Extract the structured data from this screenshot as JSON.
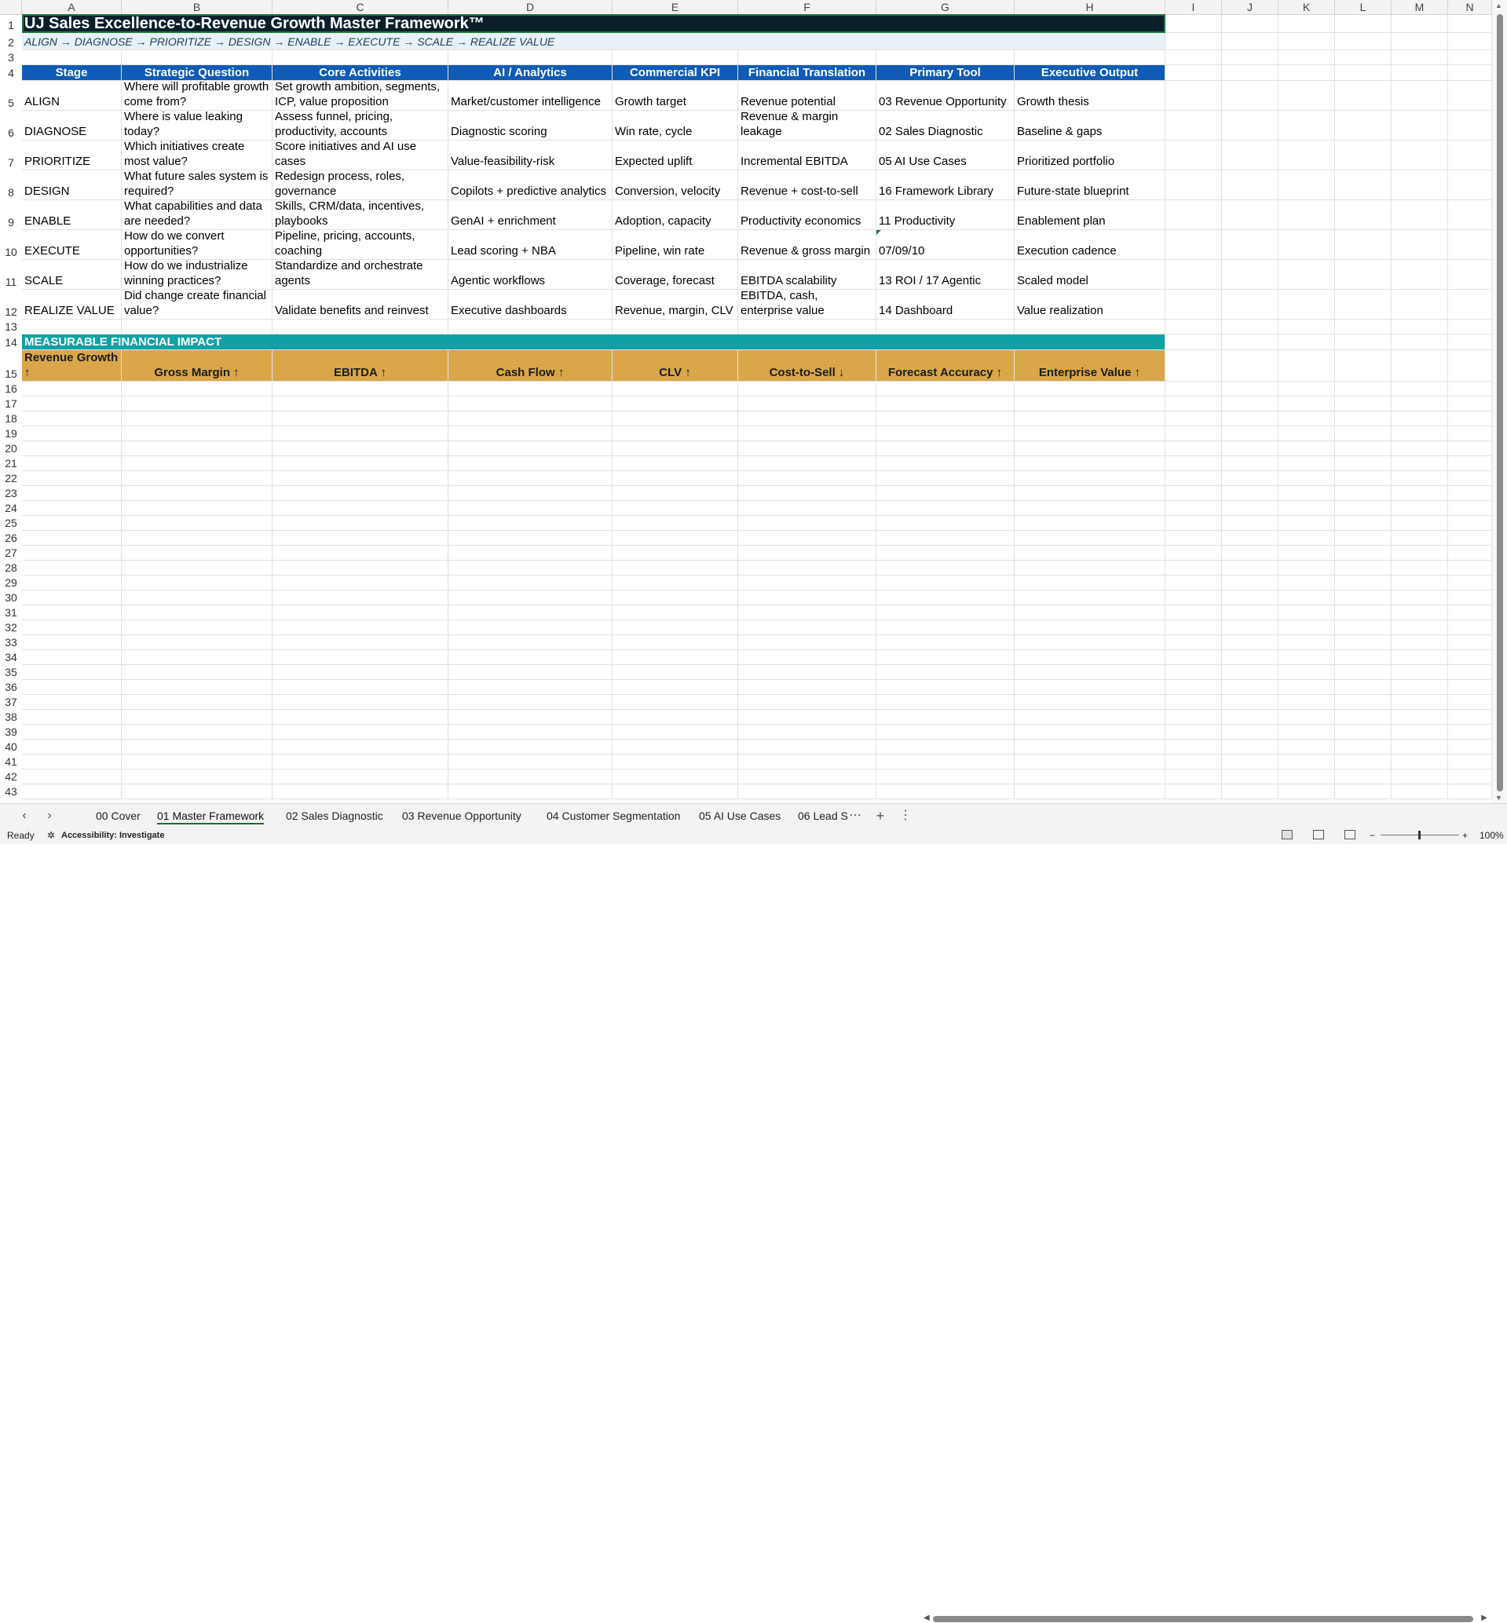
{
  "columns": [
    "A",
    "B",
    "C",
    "D",
    "E",
    "F",
    "G",
    "H",
    "I",
    "J",
    "K",
    "L",
    "M",
    "N"
  ],
  "title": "UJ Sales Excellence-to-Revenue Growth Master Framework™",
  "subtitle": "ALIGN → DIAGNOSE → PRIORITIZE → DESIGN → ENABLE → EXECUTE → SCALE → REALIZE VALUE",
  "headers": [
    "Stage",
    "Strategic Question",
    "Core Activities",
    "AI / Analytics",
    "Commercial KPI",
    "Financial Translation",
    "Primary Tool",
    "Executive Output"
  ],
  "rows": [
    [
      "ALIGN",
      "Where will profitable growth come from?",
      "Set growth ambition, segments, ICP, value proposition",
      "Market/customer intelligence",
      "Growth target",
      "Revenue potential",
      "03 Revenue Opportunity",
      "Growth thesis"
    ],
    [
      "DIAGNOSE",
      "Where is value leaking today?",
      "Assess funnel, pricing, productivity, accounts",
      "Diagnostic scoring",
      "Win rate, cycle",
      "Revenue & margin leakage",
      "02 Sales Diagnostic",
      "Baseline & gaps"
    ],
    [
      "PRIORITIZE",
      "Which initiatives create most value?",
      "Score initiatives and AI use cases",
      "Value-feasibility-risk",
      "Expected uplift",
      "Incremental EBITDA",
      "05 AI Use Cases",
      "Prioritized portfolio"
    ],
    [
      "DESIGN",
      "What future sales system is required?",
      "Redesign process, roles, governance",
      "Copilots + predictive analytics",
      "Conversion, velocity",
      "Revenue + cost-to-sell",
      "16 Framework Library",
      "Future-state blueprint"
    ],
    [
      "ENABLE",
      "What capabilities and data are needed?",
      "Skills, CRM/data, incentives, playbooks",
      "GenAI + enrichment",
      "Adoption, capacity",
      "Productivity economics",
      "11 Productivity",
      "Enablement plan"
    ],
    [
      "EXECUTE",
      "How do we convert opportunities?",
      "Pipeline, pricing, accounts, coaching",
      "Lead scoring + NBA",
      "Pipeline, win rate",
      "Revenue & gross margin",
      "07/09/10",
      "Execution cadence"
    ],
    [
      "SCALE",
      "How do we industrialize winning practices?",
      "Standardize and orchestrate agents",
      "Agentic workflows",
      "Coverage, forecast",
      "EBITDA scalability",
      "13 ROI / 17 Agentic",
      "Scaled model"
    ],
    [
      "REALIZE VALUE",
      "Did change create financial value?",
      "Validate benefits and reinvest",
      "Executive dashboards",
      "Revenue, margin, CLV",
      "EBITDA, cash, enterprise value",
      "14 Dashboard",
      "Value realization"
    ]
  ],
  "impact_title": "MEASURABLE FINANCIAL IMPACT",
  "impact": [
    "Revenue Growth ↑",
    "Gross Margin ↑",
    "EBITDA ↑",
    "Cash Flow ↑",
    "CLV ↑",
    "Cost-to-Sell ↓",
    "Forecast Accuracy ↑",
    "Enterprise Value ↑"
  ],
  "tabs": [
    "00 Cover",
    "01 Master Framework",
    "02 Sales Diagnostic",
    "03 Revenue Opportunity",
    "04 Customer Segmentation",
    "05 AI Use Cases",
    "06 Lead S"
  ],
  "active_tab": "01 Master Framework",
  "status": {
    "ready": "Ready",
    "accessibility": "Accessibility: Investigate",
    "zoom": "100%"
  },
  "colors": {
    "title_bg": "#0b1f2b",
    "header_bg": "#0f5bb5",
    "impact_bg": "#0ea2a5",
    "impact_row_bg": "#d9a74a",
    "active_tab_underline": "#1d6b2e"
  }
}
